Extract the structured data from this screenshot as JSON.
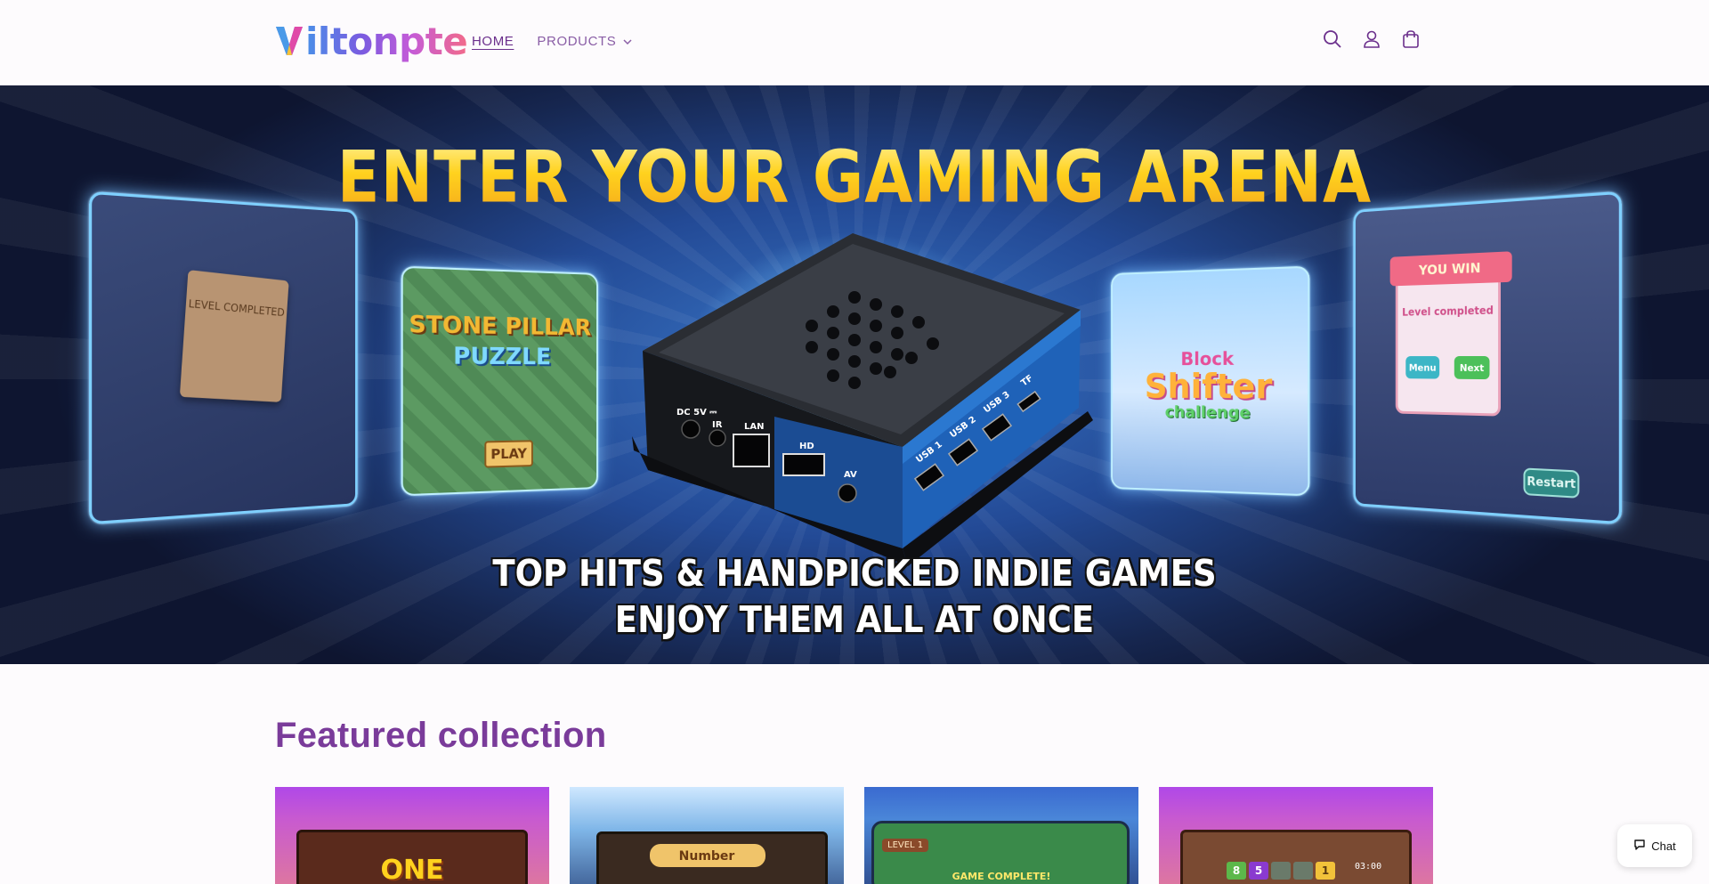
{
  "brand": {
    "logo_text": "iltonpte",
    "logo_initial": "V"
  },
  "nav": {
    "home_label": "HOME",
    "products_label": "PRODUCTS"
  },
  "header_icons": [
    "search-icon",
    "account-icon",
    "cart-icon"
  ],
  "hero": {
    "title": "ENTER YOUR GAMING ARENA",
    "subtitle_line1": "TOP HITS & HANDPICKED INDIE GAMES",
    "subtitle_line2": "ENJOY THEM ALL AT ONCE",
    "panels": {
      "left_text": "LEVEL COMPLETED",
      "stone_line1": "STONE PILLAR",
      "stone_line2": "PUZZLE",
      "stone_button": "PLAY",
      "block_line1": "Block",
      "block_line2": "Shifter",
      "block_line3": "challenge",
      "win_title": "YOU WIN",
      "win_sub": "Level completed",
      "win_menu": "Menu",
      "win_next": "Next",
      "win_restart": "Restart"
    },
    "device_ports": {
      "dc": "DC 5V ⎓",
      "ir": "IR",
      "lan": "LAN",
      "hd": "HD",
      "av": "AV",
      "usb1": "USB 1",
      "usb2": "USB 2",
      "usb3": "USB 3",
      "tf": "TF"
    }
  },
  "featured": {
    "title": "Featured collection",
    "products": [
      {
        "label": "ONE"
      },
      {
        "label": "Number"
      },
      {
        "label": "GAME COMPLETE!",
        "level": "LEVEL 1"
      },
      {
        "tiles": [
          "8",
          "5",
          "",
          "",
          "1"
        ],
        "time": "03:00"
      }
    ]
  },
  "chat": {
    "label": "Chat"
  },
  "colors": {
    "accent": "#7a3b9a",
    "hero_title": "#ffd21e",
    "background": "#fdfbfd"
  }
}
